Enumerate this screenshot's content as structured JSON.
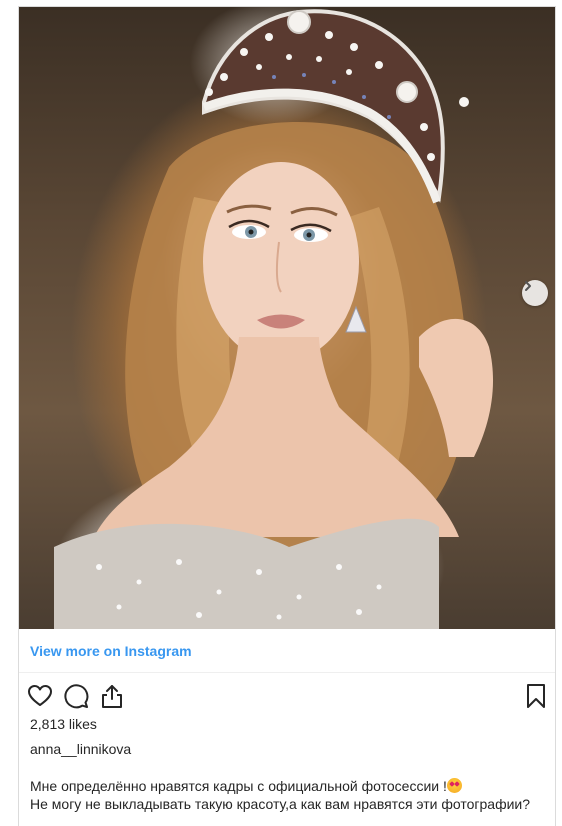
{
  "post": {
    "image_alt": "Portrait photo of a woman with long wavy blonde hair wearing a jeweled crown and sparkling dress",
    "view_more_label": "View more on Instagram",
    "likes_text": "2,813 likes",
    "username": "anna__linnikova",
    "caption_line1": "Мне определённо нравятся кадры с официальной фотосессии !",
    "caption_line2": "Не могу не выкладывать такую красоту,а как вам нравятся эти фотографии?",
    "caption_emoji": "heart-eyes-emoji"
  },
  "icons": {
    "like": "heart-icon",
    "comment": "comment-icon",
    "share": "share-icon",
    "save": "bookmark-icon",
    "next": "chevron-right-icon"
  },
  "colors": {
    "link": "#3897f0",
    "text": "#262626",
    "border": "#dbdbdb"
  }
}
